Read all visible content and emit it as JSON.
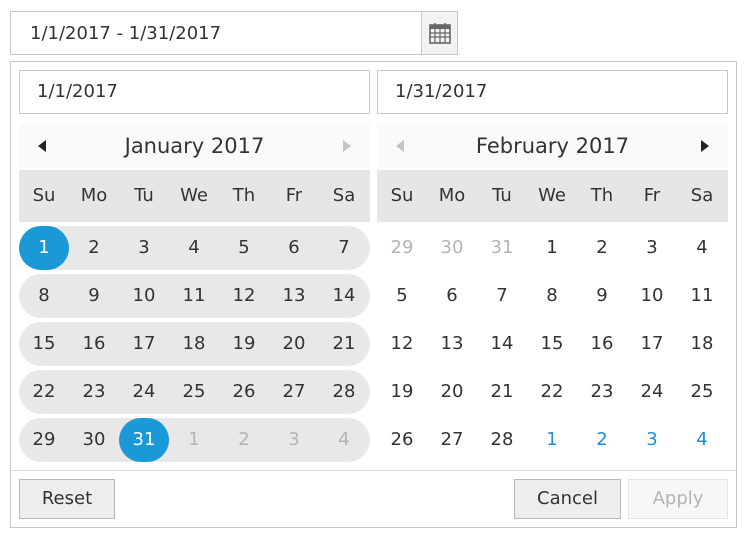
{
  "range_input": {
    "value": "1/1/2017 - 1/31/2017",
    "icon": "calendar-icon"
  },
  "start_field": {
    "value": "1/1/2017"
  },
  "end_field": {
    "value": "1/31/2017"
  },
  "weekdays": [
    "Su",
    "Mo",
    "Tu",
    "We",
    "Th",
    "Fr",
    "Sa"
  ],
  "calendars": [
    {
      "title": "January 2017",
      "weeks": [
        [
          "1",
          "2",
          "3",
          "4",
          "5",
          "6",
          "7"
        ],
        [
          "8",
          "9",
          "10",
          "11",
          "12",
          "13",
          "14"
        ],
        [
          "15",
          "16",
          "17",
          "18",
          "19",
          "20",
          "21"
        ],
        [
          "22",
          "23",
          "24",
          "25",
          "26",
          "27",
          "28"
        ],
        [
          "29",
          "30",
          "31",
          "1",
          "2",
          "3",
          "4"
        ]
      ]
    },
    {
      "title": "February 2017",
      "weeks": [
        [
          "29",
          "30",
          "31",
          "1",
          "2",
          "3",
          "4"
        ],
        [
          "5",
          "6",
          "7",
          "8",
          "9",
          "10",
          "11"
        ],
        [
          "12",
          "13",
          "14",
          "15",
          "16",
          "17",
          "18"
        ],
        [
          "19",
          "20",
          "21",
          "22",
          "23",
          "24",
          "25"
        ],
        [
          "26",
          "27",
          "28",
          "1",
          "2",
          "3",
          "4"
        ]
      ]
    }
  ],
  "buttons": {
    "reset": "Reset",
    "cancel": "Cancel",
    "apply": "Apply"
  },
  "colors": {
    "selected": "#1b99d6",
    "in_range": "#e8e8e8",
    "next_month_day": "#1e8fd3",
    "muted_day": "#b4b4b4"
  }
}
